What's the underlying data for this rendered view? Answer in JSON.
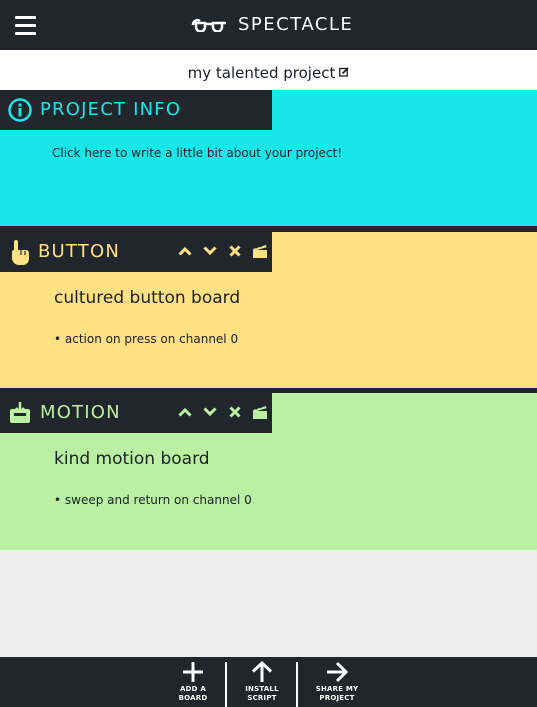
{
  "header": {
    "title": "SPECTACLE",
    "menu_icon": "hamburger-menu-icon",
    "logo_icon": "spectacles-icon"
  },
  "project": {
    "name": "my talented project",
    "edit_icon": "edit-icon"
  },
  "sections": {
    "info": {
      "title": "PROJECT INFO",
      "icon": "info-icon",
      "description": "Click here to write a little bit about your project!",
      "color": "#18e6e8"
    },
    "button": {
      "title": "BUTTON",
      "icon": "pointing-hand-icon",
      "board_name": "cultured button board",
      "detail": "• action on press on channel 0",
      "color": "#ffe082"
    },
    "motion": {
      "title": "MOTION",
      "icon": "motion-box-icon",
      "board_name": "kind motion board",
      "detail": "• sweep and return on channel 0",
      "color": "#b9f0a2"
    }
  },
  "controls": [
    "chevron-up-icon",
    "chevron-down-icon",
    "close-icon",
    "clapperboard-icon"
  ],
  "bottom_bar": {
    "add_board": {
      "line1": "ADD A",
      "line2": "BOARD",
      "icon": "plus-icon"
    },
    "install_script": {
      "line1": "INSTALL",
      "line2": "SCRIPT",
      "icon": "arrow-up-icon"
    },
    "share_project": {
      "line1": "SHARE MY",
      "line2": "PROJECT",
      "icon": "arrow-right-icon"
    }
  },
  "colors": {
    "dark": "#20262b",
    "background": "#eeeeee"
  }
}
